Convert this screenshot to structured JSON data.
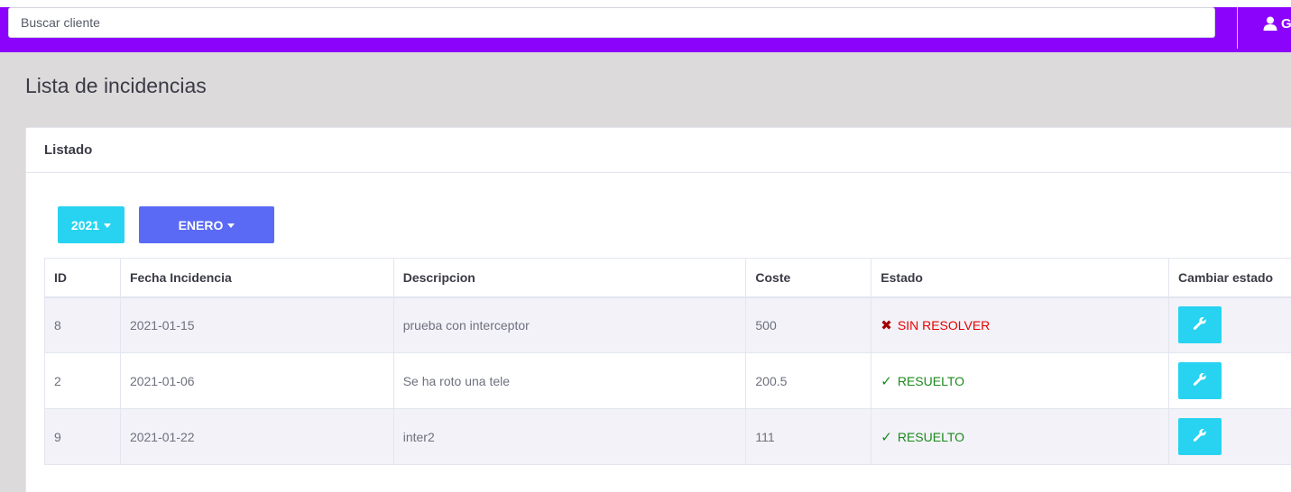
{
  "topbar": {
    "search_placeholder": "Buscar cliente",
    "user_name": "G",
    "user_icon": "user-icon",
    "accent_color": "#8c03fc"
  },
  "page": {
    "title": "Lista de incidencias"
  },
  "card": {
    "title": "Listado"
  },
  "filters": {
    "year": "2021",
    "month": "ENERO"
  },
  "table": {
    "columns": [
      "ID",
      "Fecha Incidencia",
      "Descripcion",
      "Coste",
      "Estado",
      "Cambiar estado"
    ],
    "rows": [
      {
        "id": "8",
        "fecha": "2021-01-15",
        "descripcion": "prueba con interceptor",
        "coste": "500",
        "estado": "SIN RESOLVER",
        "estado_mark": "✖",
        "estado_kind": "bad"
      },
      {
        "id": "2",
        "fecha": "2021-01-06",
        "descripcion": "Se ha roto una tele",
        "coste": "200.5",
        "estado": "RESUELTO",
        "estado_mark": "✓",
        "estado_kind": "ok"
      },
      {
        "id": "9",
        "fecha": "2021-01-22",
        "descripcion": "inter2",
        "coste": "111",
        "estado": "RESUELTO",
        "estado_mark": "✓",
        "estado_kind": "ok"
      }
    ],
    "action_icon": "wrench-icon"
  },
  "colors": {
    "info": "#27d3f0",
    "primary": "#5a6af5",
    "danger": "#e60000",
    "success": "#1b8a1b"
  }
}
